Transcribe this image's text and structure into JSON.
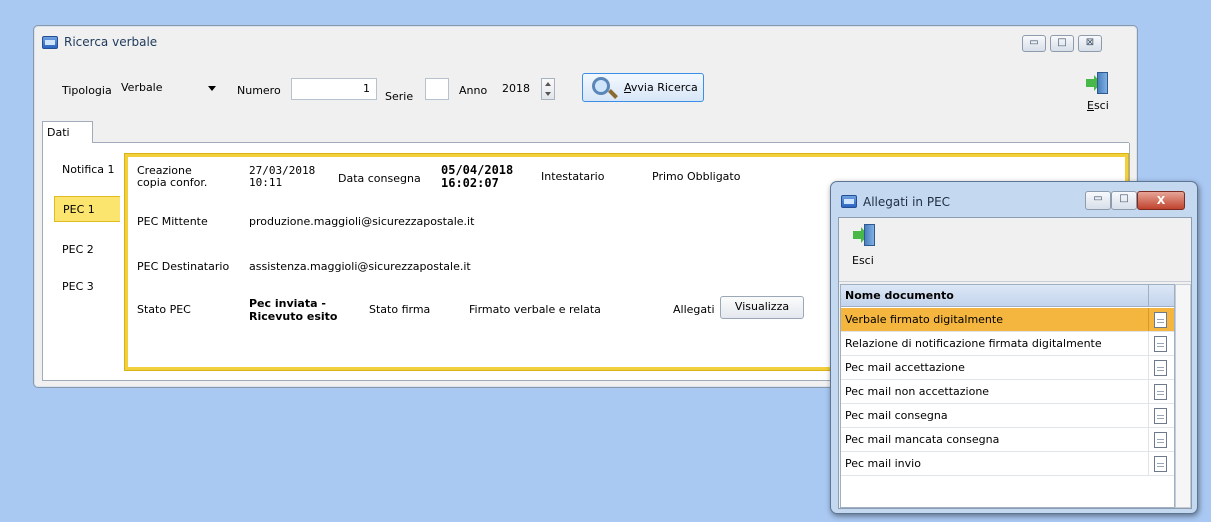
{
  "main_window": {
    "title": "Ricerca verbale",
    "controls": {
      "minimize": "▭",
      "maximize": "□",
      "close": "⊠"
    },
    "search": {
      "tipologia_label": "Tipologia",
      "tipologia_value": "Verbale",
      "numero_label": "Numero",
      "numero_value": "1",
      "serie_label": "Serie",
      "serie_value": "",
      "anno_label": "Anno",
      "anno_value": "2018",
      "search_button_pre": "A",
      "search_button_rest": "vvia Ricerca",
      "exit_pre": "E",
      "exit_rest": "sci"
    },
    "tab": "Dati",
    "side_tabs": [
      "Notifica 1",
      "PEC 1",
      "PEC 2",
      "PEC 3"
    ],
    "pec": {
      "creazione_label": "Creazione copia confor.",
      "creazione_date": "27/03/2018",
      "creazione_time": "10:11",
      "data_consegna_label": "Data consegna",
      "data_consegna_date": "05/04/2018",
      "data_consegna_time": "16:02:07",
      "intestatario_label": "Intestatario",
      "intestatario_value": "Primo Obbligato",
      "mittente_label": "PEC Mittente",
      "mittente_value": "produzione.maggioli@sicurezzapostale.it",
      "destinatario_label": "PEC Destinatario",
      "destinatario_value": "assistenza.maggioli@sicurezzapostale.it",
      "stato_pec_label": "Stato PEC",
      "stato_pec_line1": "Pec inviata -",
      "stato_pec_line2": "Ricevuto esito",
      "stato_firma_label": "Stato firma",
      "stato_firma_value": "Firmato verbale e relata",
      "allegati_label": "Allegati",
      "visualizza_button": "Visualizza"
    }
  },
  "popup": {
    "title": "Allegati in PEC",
    "close": "X",
    "exit_label": "Esci",
    "column_header": "Nome documento",
    "documents": [
      "Verbale firmato digitalmente",
      "Relazione di notificazione firmata digitalmente",
      "Pec mail accettazione",
      "Pec mail non accettazione",
      "Pec mail consegna",
      "Pec mail mancata consegna",
      "Pec mail invio"
    ],
    "selected_index": 0
  },
  "colors": {
    "desktop": "#a9c8f2",
    "selected_row": "#f4b63f",
    "active_tab": "#fbe56e",
    "frame": "#f2cf3c"
  }
}
